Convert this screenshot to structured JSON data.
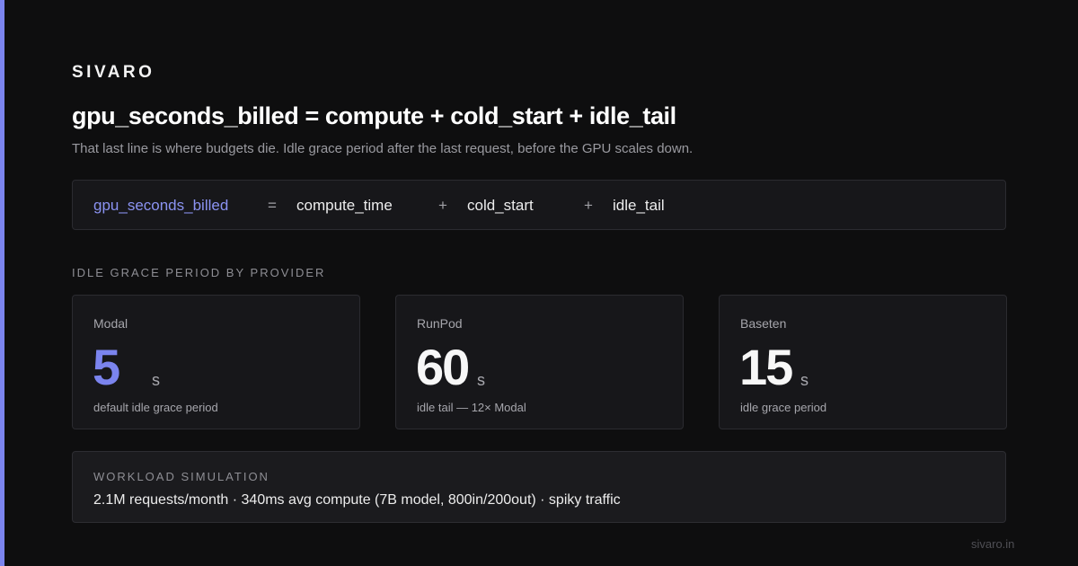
{
  "brand": "SIVARO",
  "headline": "gpu_seconds_billed = compute + cold_start + idle_tail",
  "subline": "That last line is where budgets die. Idle grace period after the last request, before the GPU scales down.",
  "formula": {
    "lhs": "gpu_seconds_billed",
    "eq": "=",
    "term1": "compute_time",
    "plus1": "+",
    "term2": "cold_start",
    "plus2": "+",
    "term3": "idle_tail"
  },
  "section_label": "IDLE GRACE PERIOD BY PROVIDER",
  "providers": [
    {
      "name": "Modal",
      "value": "5",
      "unit": "s",
      "desc": "default idle grace period",
      "highlight": true
    },
    {
      "name": "RunPod",
      "value": "60",
      "unit": "s",
      "desc": "idle tail — 12× Modal",
      "highlight": false
    },
    {
      "name": "Baseten",
      "value": "15",
      "unit": "s",
      "desc": "idle grace period",
      "highlight": false
    }
  ],
  "workload": {
    "label": "WORKLOAD SIMULATION",
    "text": "2.1M requests/month · 340ms avg compute (7B model, 800in/200out) · spiky traffic"
  },
  "footer": "sivaro.in",
  "colors": {
    "accent": "#7b84ee",
    "background": "#0e0e0f",
    "card": "#17171a"
  }
}
